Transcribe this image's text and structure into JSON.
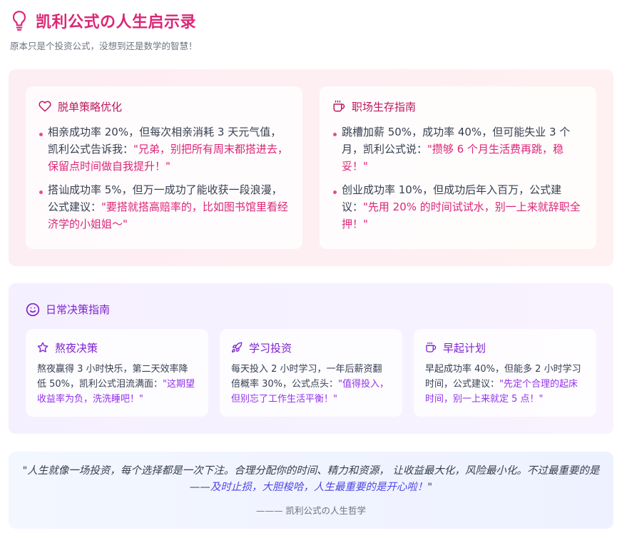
{
  "header": {
    "title": "凯利公式の人生启示录",
    "subtitle": "原本只是个投资公式，没想到还是数学的智慧！",
    "icon": "lightbulb-icon"
  },
  "colors": {
    "accent_pink": "#db2777",
    "accent_purple": "#7e22ce",
    "accent_blue": "#4f46e5"
  },
  "romance": {
    "icon": "heart-icon",
    "title": "脱单策略优化",
    "items": [
      {
        "text": "相亲成功率 20%，但每次相亲消耗 3 天元气值，凯利公式告诉我：",
        "highlight": "\"兄弟，别把所有周末都搭进去，保留点时间做自我提升！\""
      },
      {
        "text": "搭讪成功率 5%，但万一成功了能收获一段浪漫，公式建议：",
        "highlight": "\"要搭就搭高赔率的，比如图书馆里看经济学的小姐姐～\""
      }
    ]
  },
  "career": {
    "icon": "coffee-icon",
    "title": "职场生存指南",
    "items": [
      {
        "text": "跳槽加薪 50%，成功率 40%，但可能失业 3 个月，凯利公式说：",
        "highlight": "\"攒够 6 个月生活费再跳，稳妥！\""
      },
      {
        "text": "创业成功率 10%，但成功后年入百万，公式建议：",
        "highlight": "\"先用 20% 的时间试试水，别一上来就辞职全押！\""
      }
    ]
  },
  "daily": {
    "icon": "smile-icon",
    "title": "日常决策指南",
    "cards": [
      {
        "icon": "star-icon",
        "title": "熬夜决策",
        "text": "熬夜赢得 3 小时快乐，第二天效率降低 50%，凯利公式泪流满面：",
        "highlight": "\"这期望收益率为负，洗洗睡吧！\""
      },
      {
        "icon": "rocket-icon",
        "title": "学习投资",
        "text": "每天投入 2 小时学习，一年后薪资翻倍概率 30%，公式点头：",
        "highlight": "\"值得投入，但别忘了工作生活平衡！\""
      },
      {
        "icon": "coffee-icon",
        "title": "早起计划",
        "text": "早起成功率 40%，但能多 2 小时学习时间，公式建议：",
        "highlight": "\"先定个合理的起床时间，别一上来就定 5 点！\""
      }
    ]
  },
  "quote": {
    "text": "\"人生就像一场投资，每个选择都是一次下注。合理分配你的时间、精力和资源， 让收益最大化，风险最小化。不过最重要的是 ——",
    "highlight": "及时止损，大胆梭哈，人生最重要的是开心啦！",
    "end": "\"",
    "attribution": "——— 凯利公式の人生哲学"
  }
}
